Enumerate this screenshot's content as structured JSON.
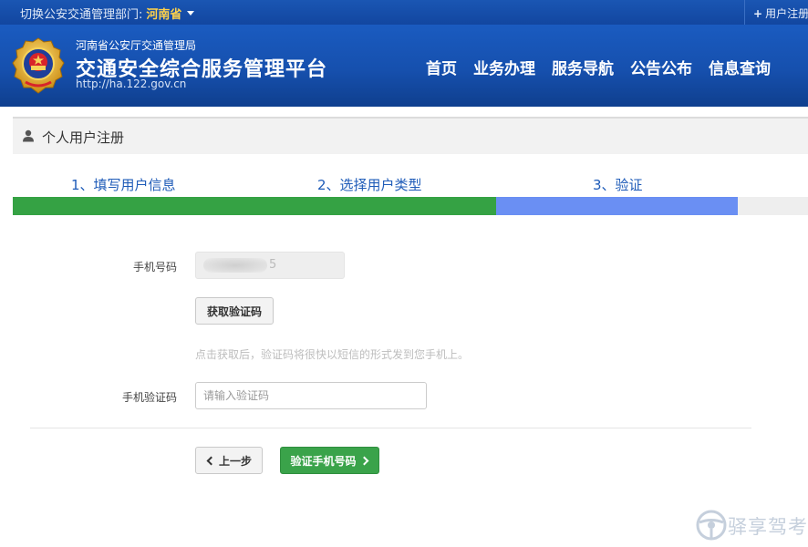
{
  "topbar": {
    "switch_label": "切换公安交通管理部门:",
    "province": "河南省",
    "register_link": "用户注册"
  },
  "header": {
    "org": "河南省公安厅交通管理局",
    "platform": "交通安全综合服务管理平台",
    "url": "http://ha.122.gov.cn",
    "nav": [
      "首页",
      "业务办理",
      "服务导航",
      "公告公布",
      "信息查询"
    ]
  },
  "page": {
    "title": "个人用户注册"
  },
  "steps": {
    "items": [
      "1、填写用户信息",
      "2、选择用户类型",
      "3、验证"
    ],
    "colors": {
      "done": "#35a244",
      "current": "#6a8ff3",
      "pending": "#eeeeee"
    }
  },
  "form": {
    "phone_label": "手机号码",
    "phone_value_tail": "5",
    "get_code_button": "获取验证码",
    "hint": "点击获取后，验证码将很快以短信的形式发到您手机上。",
    "code_label": "手机验证码",
    "code_placeholder": "请输入验证码",
    "prev_button": "上一步",
    "verify_button": "验证手机号码"
  },
  "watermark": {
    "text": "驿享驾考"
  }
}
